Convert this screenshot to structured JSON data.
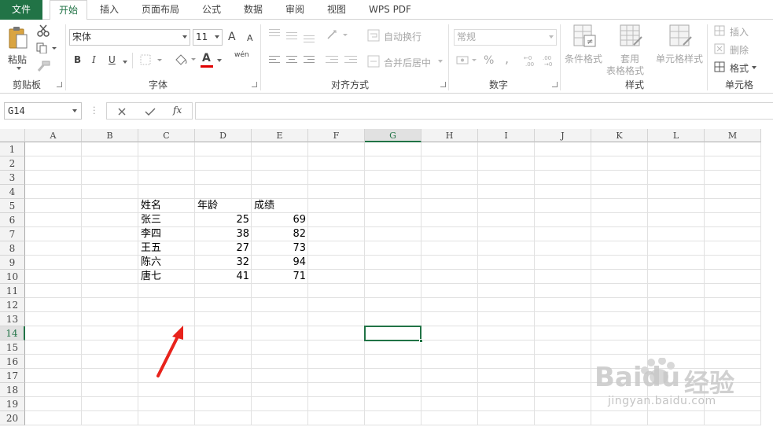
{
  "tabs": [
    "文件",
    "开始",
    "插入",
    "页面布局",
    "公式",
    "数据",
    "审阅",
    "视图",
    "WPS PDF"
  ],
  "ribbon": {
    "clipboard": {
      "paste": "剪贴板",
      "paste_btn": "粘贴",
      "label": "剪贴板"
    },
    "font": {
      "family": "宋体",
      "size": "11",
      "bold": "B",
      "italic": "I",
      "underline": "U",
      "grow": "A",
      "shrink": "A",
      "font_color_icon": "A",
      "pinyin": "wén",
      "label": "字体"
    },
    "alignment": {
      "wrap_text": "自动换行",
      "merge_center": "合并后居中",
      "label": "对齐方式"
    },
    "number": {
      "format": "常规",
      "percent": "%",
      "comma": ",",
      "label": "数字"
    },
    "styles": {
      "conditional": "条件格式",
      "table_style_1": "套用",
      "table_style_2": "表格格式",
      "cell_style": "单元格样式",
      "label": "样式"
    },
    "cells": {
      "insert": "插入",
      "delete": "删除",
      "format": "格式",
      "label": "单元格"
    }
  },
  "formula_bar": {
    "name_box": "G14",
    "fx": "fx",
    "value": ""
  },
  "sheet": {
    "columns": [
      "A",
      "B",
      "C",
      "D",
      "E",
      "F",
      "G",
      "H",
      "I",
      "J",
      "K",
      "L",
      "M"
    ],
    "rows": [
      "1",
      "2",
      "3",
      "4",
      "5",
      "6",
      "7",
      "8",
      "9",
      "10",
      "11",
      "12",
      "13",
      "14",
      "15",
      "16",
      "17",
      "18",
      "19",
      "20"
    ],
    "selected_column": "G",
    "selected_row": "14",
    "headers": [
      "姓名",
      "年龄",
      "成绩"
    ],
    "data": [
      [
        "张三",
        "25",
        "69"
      ],
      [
        "李四",
        "38",
        "82"
      ],
      [
        "王五",
        "27",
        "73"
      ],
      [
        "陈六",
        "32",
        "94"
      ],
      [
        "唐七",
        "41",
        "71"
      ]
    ]
  },
  "watermark": {
    "brand": "Baidu",
    "brand_cn": "经验",
    "url": "jingyan.baidu.com"
  },
  "colors": {
    "accent": "#217346",
    "annotation_arrow": "#e8231c"
  }
}
